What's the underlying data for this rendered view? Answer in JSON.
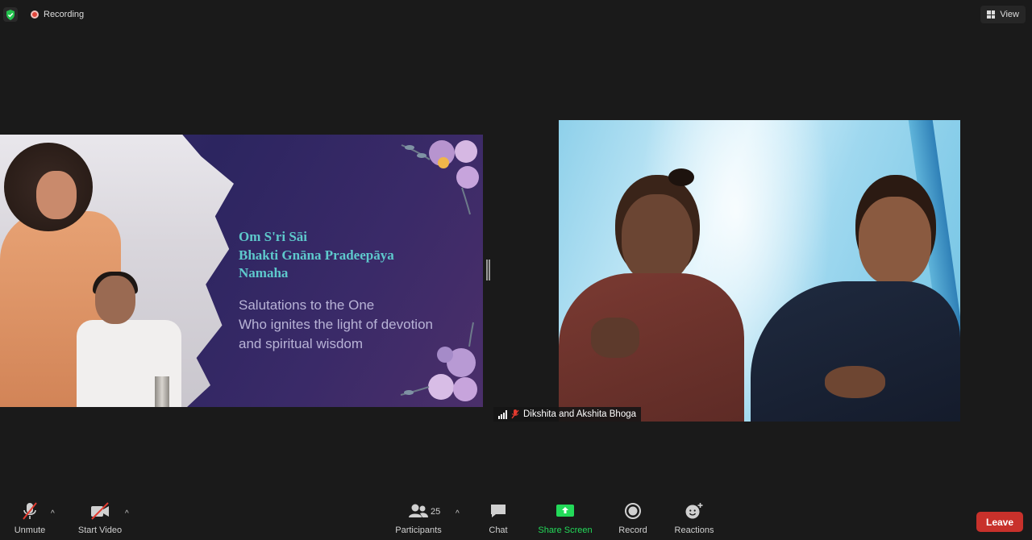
{
  "topbar": {
    "recording_label": "Recording",
    "view_label": "View",
    "icons": [
      "shield-check-icon",
      "recording-dot-icon",
      "grid-view-icon"
    ]
  },
  "slide": {
    "title_lines": [
      "Om S'ri Sāi",
      "Bhakti Gnāna Pradeepāya",
      "Namaha"
    ],
    "subtitle_lines": [
      "Salutations to the One",
      "Who ignites the light of devotion",
      "and spiritual wisdom"
    ]
  },
  "participant": {
    "name": "Dikshita and Akshita  Bhoga",
    "muted": true
  },
  "toolbar": {
    "unmute_label": "Unmute",
    "start_video_label": "Start Video",
    "participants_label": "Participants",
    "participants_count": "25",
    "chat_label": "Chat",
    "share_screen_label": "Share Screen",
    "record_label": "Record",
    "reactions_label": "Reactions",
    "leave_label": "Leave"
  },
  "colors": {
    "background": "#1a1a1a",
    "share_green": "#23d959",
    "leave_red": "#c8312b",
    "slide_title": "#5ec9cc",
    "recording_red": "#e0453a"
  }
}
